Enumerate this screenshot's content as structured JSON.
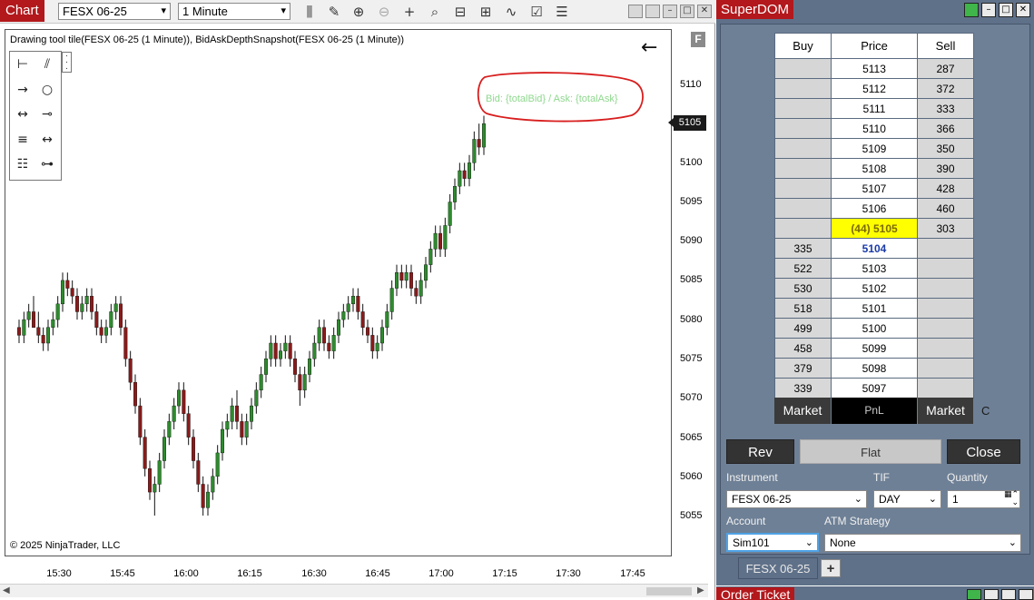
{
  "chart_window": {
    "title": "Chart",
    "instrument": "FESX 06-25",
    "interval": "1 Minute",
    "plot_title": "Drawing tool tile(FESX 06-25 (1 Minute)), BidAskDepthSnapshot(FESX 06-25 (1 Minute))",
    "annotation_text": "Bid: {totalBid} / Ask: {totalAsk}",
    "copyright": "© 2025 NinjaTrader, LLC",
    "back_icon": "←",
    "f_label": "F",
    "toolbar_icons": [
      "bar-chart-icon",
      "pencil-icon",
      "zoom-in-icon",
      "zoom-out-icon",
      "crosshair-icon",
      "data-box-icon",
      "template-icon",
      "strategy-icon",
      "indicator-icon",
      "properties-icon",
      "list-icon"
    ],
    "price_labels": [
      "5110",
      "5105",
      "5100",
      "5095",
      "5090",
      "5085",
      "5080",
      "5075",
      "5070",
      "5065",
      "5060",
      "5055"
    ],
    "current_price": "5105",
    "time_labels": [
      "15:30",
      "15:45",
      "16:00",
      "16:15",
      "16:30",
      "16:45",
      "17:00",
      "17:15",
      "17:30",
      "17:45"
    ]
  },
  "chart_data": {
    "type": "candlestick",
    "instrument": "FESX 06-25",
    "interval": "1 Minute",
    "ylim": [
      5052,
      5114
    ],
    "x_range": [
      "15:26",
      "17:53"
    ],
    "up_color": "#2e8b2e",
    "down_color": "#8b1a1a",
    "candles": [
      [
        5079,
        5080,
        5077,
        5078
      ],
      [
        5078,
        5081,
        5077,
        5080
      ],
      [
        5080,
        5082,
        5079,
        5081
      ],
      [
        5081,
        5083,
        5079,
        5079
      ],
      [
        5079,
        5081,
        5077,
        5078
      ],
      [
        5078,
        5079,
        5076,
        5077
      ],
      [
        5077,
        5080,
        5076,
        5079
      ],
      [
        5079,
        5081,
        5078,
        5080
      ],
      [
        5080,
        5083,
        5079,
        5082
      ],
      [
        5082,
        5086,
        5081,
        5085
      ],
      [
        5085,
        5086,
        5083,
        5084
      ],
      [
        5084,
        5085,
        5082,
        5083
      ],
      [
        5083,
        5084,
        5080,
        5081
      ],
      [
        5081,
        5083,
        5080,
        5082
      ],
      [
        5082,
        5084,
        5081,
        5083
      ],
      [
        5083,
        5084,
        5080,
        5081
      ],
      [
        5081,
        5082,
        5078,
        5079
      ],
      [
        5079,
        5080,
        5077,
        5078
      ],
      [
        5078,
        5080,
        5077,
        5079
      ],
      [
        5079,
        5082,
        5078,
        5081
      ],
      [
        5081,
        5083,
        5080,
        5082
      ],
      [
        5082,
        5083,
        5078,
        5079
      ],
      [
        5079,
        5080,
        5074,
        5075
      ],
      [
        5075,
        5076,
        5071,
        5072
      ],
      [
        5072,
        5073,
        5068,
        5069
      ],
      [
        5069,
        5070,
        5064,
        5065
      ],
      [
        5065,
        5066,
        5060,
        5061
      ],
      [
        5061,
        5062,
        5057,
        5058
      ],
      [
        5058,
        5060,
        5055,
        5059
      ],
      [
        5059,
        5063,
        5058,
        5062
      ],
      [
        5062,
        5066,
        5061,
        5065
      ],
      [
        5065,
        5068,
        5064,
        5067
      ],
      [
        5067,
        5070,
        5066,
        5069
      ],
      [
        5069,
        5072,
        5068,
        5071
      ],
      [
        5071,
        5072,
        5067,
        5068
      ],
      [
        5068,
        5069,
        5064,
        5065
      ],
      [
        5065,
        5066,
        5061,
        5062
      ],
      [
        5062,
        5063,
        5058,
        5059
      ],
      [
        5059,
        5060,
        5055,
        5056
      ],
      [
        5056,
        5059,
        5055,
        5058
      ],
      [
        5058,
        5061,
        5057,
        5060
      ],
      [
        5060,
        5064,
        5059,
        5063
      ],
      [
        5063,
        5067,
        5062,
        5066
      ],
      [
        5066,
        5068,
        5065,
        5067
      ],
      [
        5067,
        5070,
        5066,
        5069
      ],
      [
        5069,
        5071,
        5066,
        5067
      ],
      [
        5067,
        5068,
        5064,
        5065
      ],
      [
        5065,
        5068,
        5064,
        5067
      ],
      [
        5067,
        5070,
        5066,
        5069
      ],
      [
        5069,
        5072,
        5068,
        5071
      ],
      [
        5071,
        5074,
        5070,
        5073
      ],
      [
        5073,
        5076,
        5072,
        5075
      ],
      [
        5075,
        5078,
        5074,
        5077
      ],
      [
        5077,
        5078,
        5074,
        5075
      ],
      [
        5075,
        5077,
        5074,
        5076
      ],
      [
        5076,
        5078,
        5075,
        5077
      ],
      [
        5077,
        5078,
        5074,
        5075
      ],
      [
        5075,
        5076,
        5072,
        5073
      ],
      [
        5073,
        5074,
        5069,
        5071
      ],
      [
        5071,
        5074,
        5070,
        5073
      ],
      [
        5073,
        5076,
        5072,
        5075
      ],
      [
        5075,
        5078,
        5074,
        5077
      ],
      [
        5077,
        5080,
        5076,
        5079
      ],
      [
        5079,
        5080,
        5076,
        5077
      ],
      [
        5077,
        5078,
        5075,
        5076
      ],
      [
        5076,
        5079,
        5075,
        5078
      ],
      [
        5078,
        5081,
        5077,
        5080
      ],
      [
        5080,
        5082,
        5079,
        5081
      ],
      [
        5081,
        5083,
        5080,
        5082
      ],
      [
        5082,
        5084,
        5081,
        5083
      ],
      [
        5083,
        5084,
        5080,
        5081
      ],
      [
        5081,
        5082,
        5078,
        5079
      ],
      [
        5079,
        5080,
        5077,
        5078
      ],
      [
        5078,
        5079,
        5075,
        5076
      ],
      [
        5076,
        5078,
        5075,
        5077
      ],
      [
        5077,
        5080,
        5076,
        5079
      ],
      [
        5079,
        5082,
        5078,
        5081
      ],
      [
        5081,
        5085,
        5080,
        5084
      ],
      [
        5084,
        5087,
        5083,
        5086
      ],
      [
        5086,
        5087,
        5084,
        5085
      ],
      [
        5085,
        5087,
        5084,
        5086
      ],
      [
        5086,
        5087,
        5083,
        5084
      ],
      [
        5084,
        5085,
        5082,
        5083
      ],
      [
        5083,
        5086,
        5082,
        5085
      ],
      [
        5085,
        5088,
        5084,
        5087
      ],
      [
        5087,
        5090,
        5086,
        5089
      ],
      [
        5089,
        5092,
        5088,
        5091
      ],
      [
        5091,
        5092,
        5088,
        5089
      ],
      [
        5089,
        5093,
        5088,
        5092
      ],
      [
        5092,
        5096,
        5091,
        5095
      ],
      [
        5095,
        5098,
        5094,
        5097
      ],
      [
        5097,
        5100,
        5096,
        5099
      ],
      [
        5099,
        5100,
        5097,
        5098
      ],
      [
        5098,
        5101,
        5097,
        5100
      ],
      [
        5100,
        5104,
        5099,
        5103
      ],
      [
        5103,
        5105,
        5101,
        5102
      ],
      [
        5102,
        5106,
        5101,
        5105
      ]
    ]
  },
  "superdom": {
    "title": "SuperDOM",
    "headers": {
      "buy": "Buy",
      "price": "Price",
      "sell": "Sell"
    },
    "rows": [
      {
        "buy": "",
        "price": "5113",
        "sell": "287"
      },
      {
        "buy": "",
        "price": "5112",
        "sell": "372"
      },
      {
        "buy": "",
        "price": "5111",
        "sell": "333"
      },
      {
        "buy": "",
        "price": "5110",
        "sell": "366"
      },
      {
        "buy": "",
        "price": "5109",
        "sell": "350"
      },
      {
        "buy": "",
        "price": "5108",
        "sell": "390"
      },
      {
        "buy": "",
        "price": "5107",
        "sell": "428"
      },
      {
        "buy": "",
        "price": "5106",
        "sell": "460"
      },
      {
        "buy": "",
        "price": "(44) 5105",
        "sell": "303",
        "last": true
      },
      {
        "buy": "335",
        "price": "5104",
        "sell": "",
        "inside": true
      },
      {
        "buy": "522",
        "price": "5103",
        "sell": ""
      },
      {
        "buy": "530",
        "price": "5102",
        "sell": ""
      },
      {
        "buy": "518",
        "price": "5101",
        "sell": ""
      },
      {
        "buy": "499",
        "price": "5100",
        "sell": ""
      },
      {
        "buy": "458",
        "price": "5099",
        "sell": ""
      },
      {
        "buy": "379",
        "price": "5098",
        "sell": ""
      },
      {
        "buy": "339",
        "price": "5097",
        "sell": ""
      }
    ],
    "market_buy": "Market",
    "pnl": "PnL",
    "market_sell": "Market",
    "c_label": "C",
    "rev": "Rev",
    "flat": "Flat",
    "close": "Close",
    "instrument_label": "Instrument",
    "instrument_value": "FESX 06-25",
    "tif_label": "TIF",
    "tif_value": "DAY",
    "quantity_label": "Quantity",
    "quantity_value": "1",
    "account_label": "Account",
    "account_value": "Sim101",
    "atm_label": "ATM Strategy",
    "atm_value": "None",
    "tab_label": "FESX 06-25",
    "tab_add": "+"
  },
  "order_ticket": {
    "title": "Order Ticket"
  }
}
